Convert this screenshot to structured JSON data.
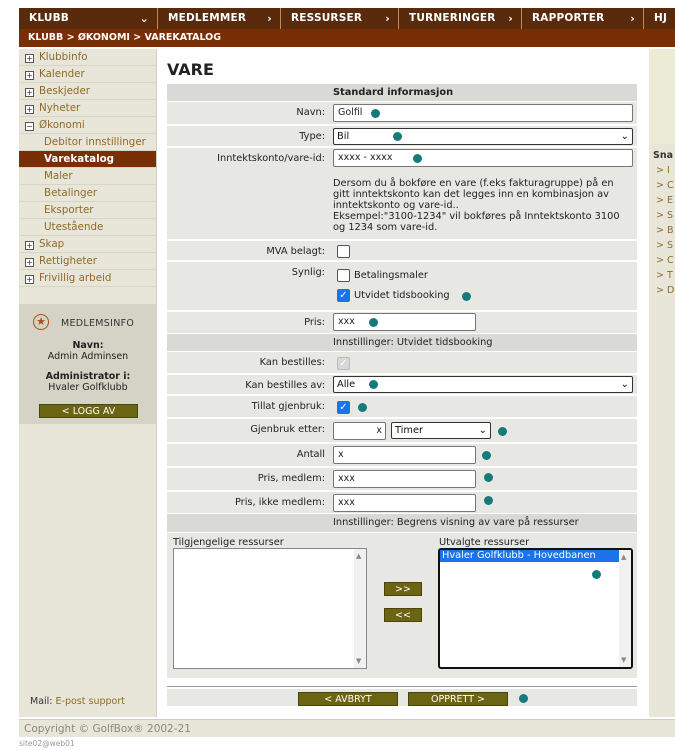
{
  "nav": {
    "items": [
      "KLUBB",
      "MEDLEMMER",
      "RESSURSER",
      "TURNERINGER",
      "RAPPORTER",
      "HJ"
    ],
    "breadcrumb": "KLUBB > ØKONOMI > VAREKATALOG"
  },
  "sidebar": {
    "items": [
      "Klubbinfo",
      "Kalender",
      "Beskjeder",
      "Nyheter",
      "Økonomi"
    ],
    "submenu": [
      "Debitor innstillinger",
      "Varekatalog",
      "Maler",
      "Betalinger",
      "Eksporter",
      "Utestående"
    ],
    "items2": [
      "Skap",
      "Rettigheter",
      "Frivillig arbeid"
    ],
    "membersinfo": {
      "heading": "MEDLEMSINFO",
      "name_label": "Navn:",
      "name": "Admin Adminsen",
      "admin_label": "Administrator i:",
      "club": "Hvaler Golfklubb",
      "logoff": "< LOGG AV"
    },
    "mail_label": "Mail:",
    "mail_link": "E-post support"
  },
  "right": {
    "title": "Sna",
    "links": [
      "> I",
      "> C",
      "> E",
      "> S",
      "> B",
      "> S",
      "> C",
      "> T",
      "> D"
    ]
  },
  "main": {
    "title": "VARE",
    "sec_standard": "Standard informasjon",
    "navn_label": "Navn:",
    "navn_value": "Golfil",
    "type_label": "Type:",
    "type_value": "Bil",
    "konto_label": "Inntektskonto/vare-id:",
    "konto_value": "xxxx - xxxx",
    "konto_help": "Dersom du å bokføre en vare (f.eks fakturagruppe) på en gitt inntektskonto kan det legges inn en kombinasjon av inntektskonto og vare-id..",
    "konto_example": "Eksempel:\"3100-1234\" vil bokføres på Inntektskonto 3100 og 1234 som vare-id.",
    "mva_label": "MVA belagt:",
    "synlig_label": "Synlig:",
    "synlig_opt1": "Betalingsmaler",
    "synlig_opt2": "Utvidet tidsbooking",
    "pris_label": "Pris:",
    "pris_value": "xxx",
    "sec_utvidet": "Innstillinger: Utvidet tidsbooking",
    "kan_bestilles_label": "Kan bestilles:",
    "bestilles_av_label": "Kan bestilles av:",
    "bestilles_av_value": "Alle",
    "gjenbruk_label": "Tillat gjenbruk:",
    "gjenbruk_etter_label": "Gjenbruk etter:",
    "gjenbruk_etter_value": "x",
    "gjenbruk_unit": "Timer",
    "antall_label": "Antall",
    "antall_value": "x",
    "pris_medlem_label": "Pris, medlem:",
    "pris_medlem_value": "xxx",
    "pris_ikke_label": "Pris, ikke medlem:",
    "pris_ikke_value": "xxx",
    "sec_begrens": "Innstillinger: Begrens visning av vare på ressurser",
    "available_label": "Tilgjengelige ressurser",
    "selected_label": "Utvalgte ressurser",
    "selected_items": [
      "Hvaler Golfklubb - Hovedbanen"
    ],
    "add_btn": ">>",
    "remove_btn": "<<",
    "cancel_btn": "< AVBRYT",
    "create_btn": "OPPRETT >"
  },
  "footer": {
    "copyright": "Copyright © GolfBox® 2002-21",
    "site": "site02@web01"
  }
}
